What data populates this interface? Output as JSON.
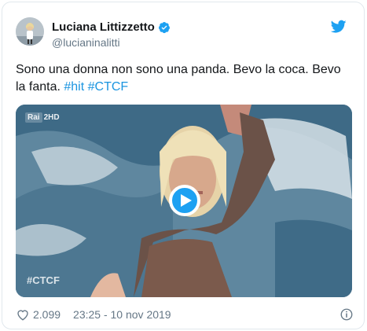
{
  "author": {
    "name": "Luciana Littizzetto",
    "handle": "@lucianinalitti",
    "verified": true
  },
  "tweet": {
    "text": "Sono una donna non sono una panda. Bevo la coca. Bevo la fanta. ",
    "hashtags": [
      "#hit",
      "#CTCF"
    ]
  },
  "media": {
    "channel_logo": "Rai",
    "channel_number": "2HD",
    "watermark": "#CTCF"
  },
  "footer": {
    "like_count": "2.099",
    "timestamp": "23:25 - 10 nov 2019"
  },
  "colors": {
    "accent": "#1da1f2",
    "hashtag": "#1b95e0",
    "secondary_text": "#657786"
  },
  "icons": [
    "verified-icon",
    "twitter-bird-icon",
    "play-icon",
    "heart-icon",
    "info-icon"
  ]
}
